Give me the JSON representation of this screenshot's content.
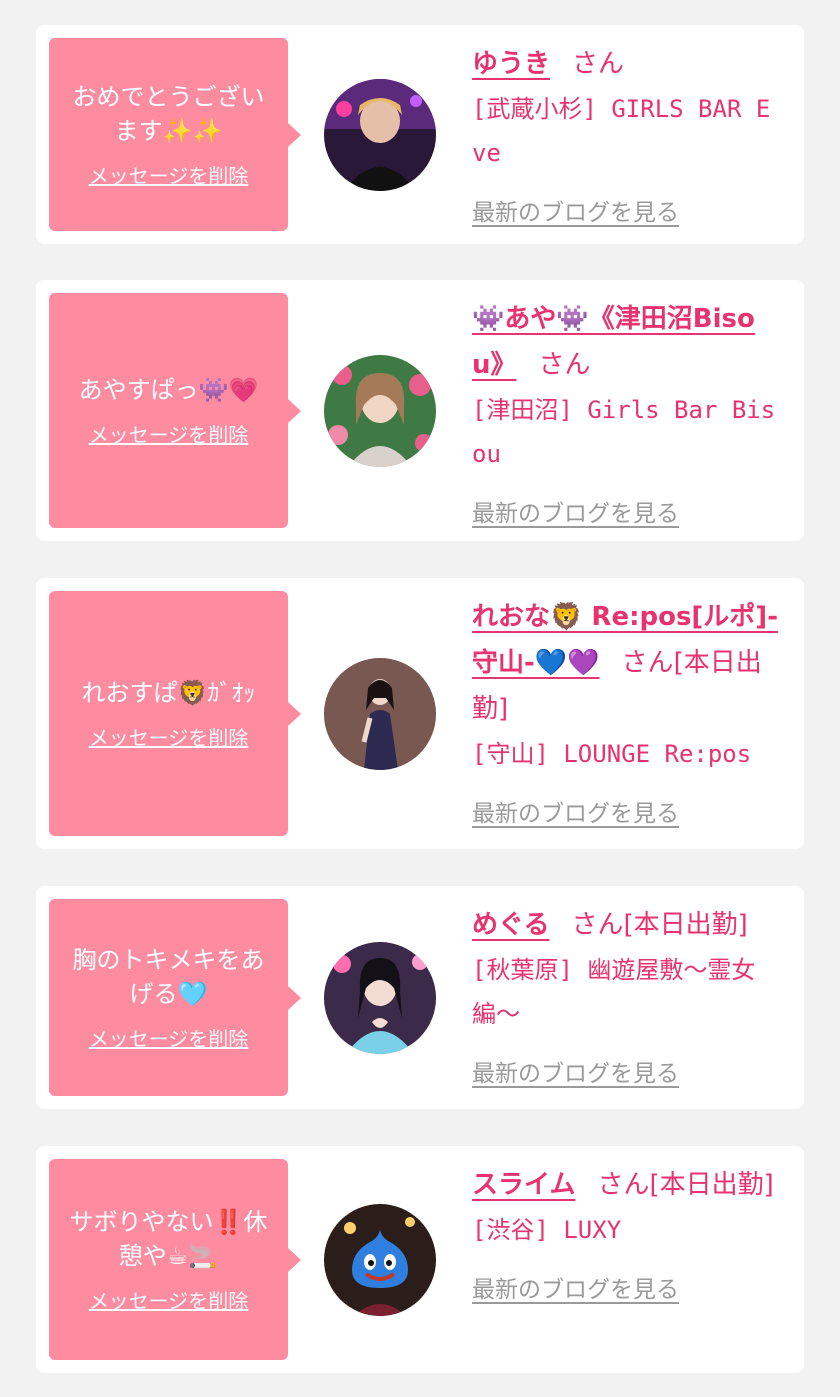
{
  "delete_label": "メッセージを削除",
  "blog_label": "最新のブログを見る",
  "san_label": "さん",
  "accent_color": "#e8336e",
  "bubble_color": "#fe8ca0",
  "cards": [
    {
      "message": "おめでとうございます✨✨",
      "name": "ゆうき",
      "status": "",
      "shop": "[武蔵小杉] GIRLS BAR Eve"
    },
    {
      "message": "あやすぱっ👾💗",
      "name": "👾あや👾《津田沼Bisou》",
      "status": "",
      "shop": "[津田沼] Girls Bar Bisou"
    },
    {
      "message": "れおすぱ🦁ｶﾞｵｯ",
      "name": "れおな🦁 Re:pos[ルポ]-守山-💙💜",
      "status": "[本日出勤]",
      "shop": "[守山] LOUNGE Re:pos"
    },
    {
      "message": "胸のトキメキをあげる🩵",
      "name": "めぐる",
      "status": "[本日出勤]",
      "shop": "[秋葉原] 幽遊屋敷〜霊女編〜"
    },
    {
      "message": "サボりやない‼️休憩や☕🚬",
      "name": "スライム",
      "status": "[本日出勤]",
      "shop": "[渋谷] LUXY"
    }
  ]
}
